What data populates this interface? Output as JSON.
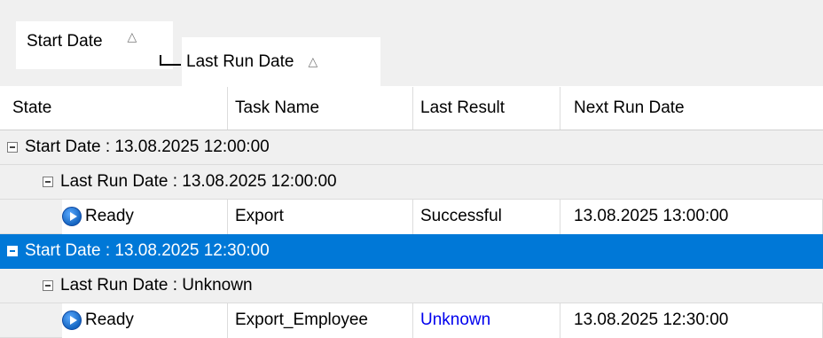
{
  "group_panel": {
    "chips": [
      {
        "label": "Start Date",
        "sort_icon": "sort-ascending-icon",
        "glyph": "△"
      },
      {
        "label": "Last Run Date",
        "sort_icon": "sort-ascending-icon",
        "glyph": "△"
      }
    ]
  },
  "columns": [
    "State",
    "Task Name",
    "Last Result",
    "Next Run Date"
  ],
  "groups": [
    {
      "label": "Start Date : 13.08.2025 12:00:00",
      "selected": false,
      "subgroup": {
        "label": "Last Run Date : 13.08.2025 12:00:00",
        "row": {
          "state": "Ready",
          "task_name": "Export",
          "last_result": "Successful",
          "next_run_date": "13.08.2025 13:00:00"
        }
      }
    },
    {
      "label": "Start Date : 13.08.2025 12:30:00",
      "selected": true,
      "subgroup": {
        "label": "Last Run Date : Unknown",
        "row": {
          "state": "Ready",
          "task_name": "Export_Employee",
          "last_result": "Unknown",
          "next_run_date": "13.08.2025 12:30:00"
        }
      }
    }
  ],
  "colors": {
    "selection": "#0078d7",
    "link": "#0000ee",
    "panel": "#f0f0f0"
  }
}
